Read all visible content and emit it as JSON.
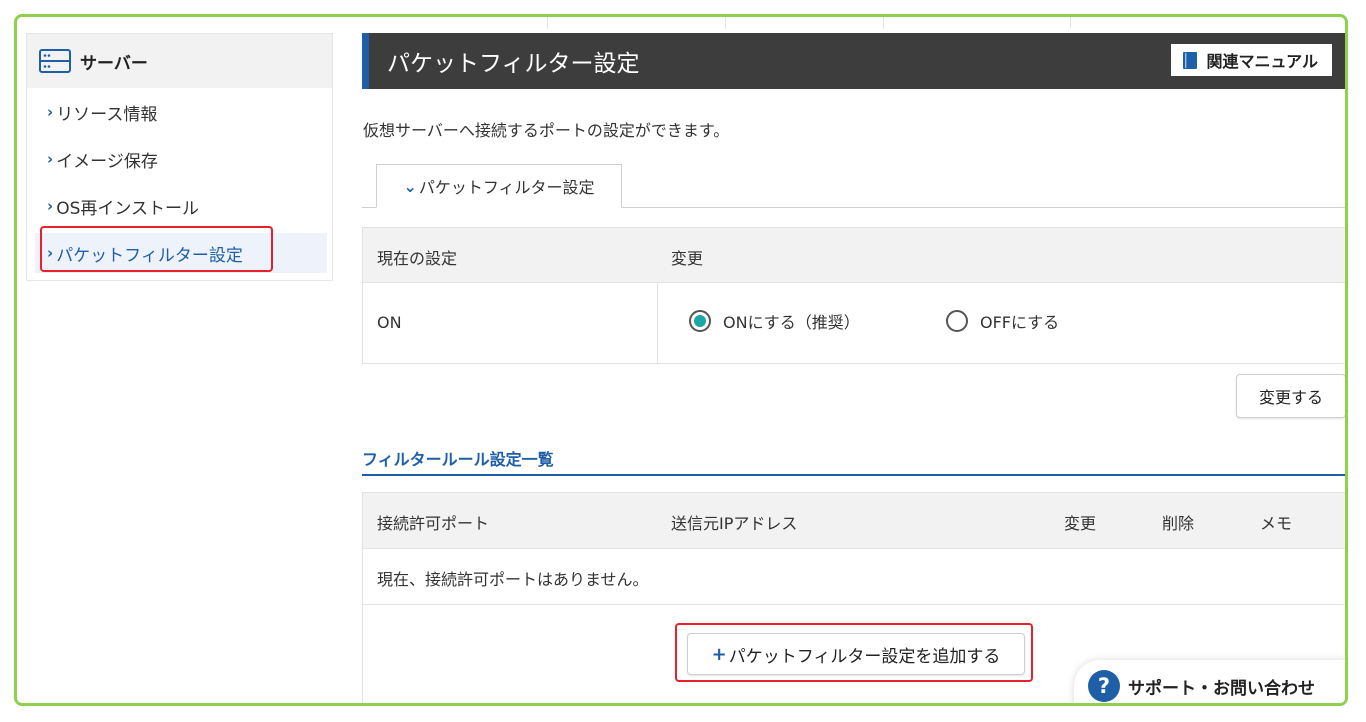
{
  "sidebar": {
    "title": "サーバー",
    "items": [
      {
        "label": "リソース情報"
      },
      {
        "label": "イメージ保存"
      },
      {
        "label": "OS再インストール"
      },
      {
        "label": "パケットフィルター設定"
      }
    ]
  },
  "header": {
    "title": "パケットフィルター設定",
    "manual_label": "関連マニュアル"
  },
  "description": "仮想サーバーへ接続するポートの設定ができます。",
  "tab": {
    "label": "パケットフィルター設定"
  },
  "settings_table": {
    "col_current": "現在の設定",
    "col_change": "変更",
    "current_value": "ON",
    "option_on": "ONにする（推奨）",
    "option_off": "OFFにする",
    "selected": "on"
  },
  "change_button": "変更する",
  "rules": {
    "section_title": "フィルタールール設定一覧",
    "columns": [
      "接続許可ポート",
      "送信元IPアドレス",
      "変更",
      "削除",
      "メモ"
    ],
    "empty_message": "現在、接続許可ポートはありません。",
    "add_button": "パケットフィルター設定を追加する"
  },
  "support": {
    "label": "サポート・お問い合わせ"
  },
  "colors": {
    "accent": "#1f5fa8",
    "radio_selected": "#1ba7a6",
    "frame": "#8fd14f",
    "highlight": "#e8202a"
  }
}
